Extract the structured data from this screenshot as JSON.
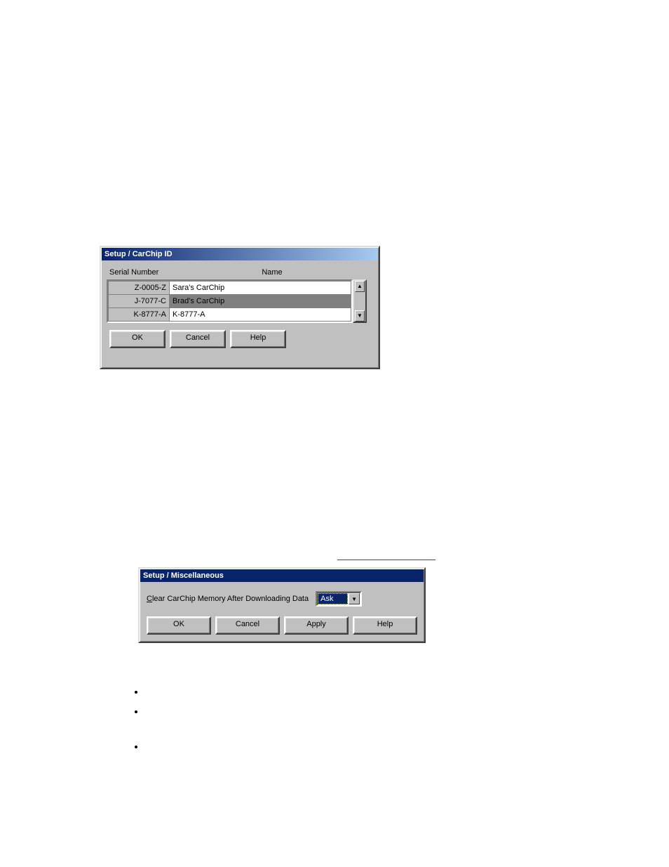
{
  "dialog1": {
    "title": "Setup / CarChip ID",
    "headers": {
      "serial": "Serial Number",
      "name": "Name"
    },
    "rows": [
      {
        "serial": "Z-0005-Z",
        "name": "Sara's CarChip",
        "selected": false
      },
      {
        "serial": "J-7077-C",
        "name": "Brad's CarChip",
        "selected": true
      },
      {
        "serial": "K-8777-A",
        "name": "K-8777-A",
        "selected": false
      }
    ],
    "buttons": {
      "ok": "OK",
      "cancel": "Cancel",
      "help": "Help"
    },
    "scroll": {
      "up": "▲",
      "down": "▼"
    }
  },
  "dialog2": {
    "title": "Setup / Miscellaneous",
    "option_label_pre": "C",
    "option_label_rest": "lear CarChip Memory After Downloading Data",
    "dropdown_value": "Ask",
    "dropdown_arrow": "▼",
    "buttons": {
      "ok": "OK",
      "cancel": "Cancel",
      "apply": "Apply",
      "help": "Help"
    }
  },
  "bullets": {
    "b1": "",
    "b2": "",
    "b3": ""
  }
}
